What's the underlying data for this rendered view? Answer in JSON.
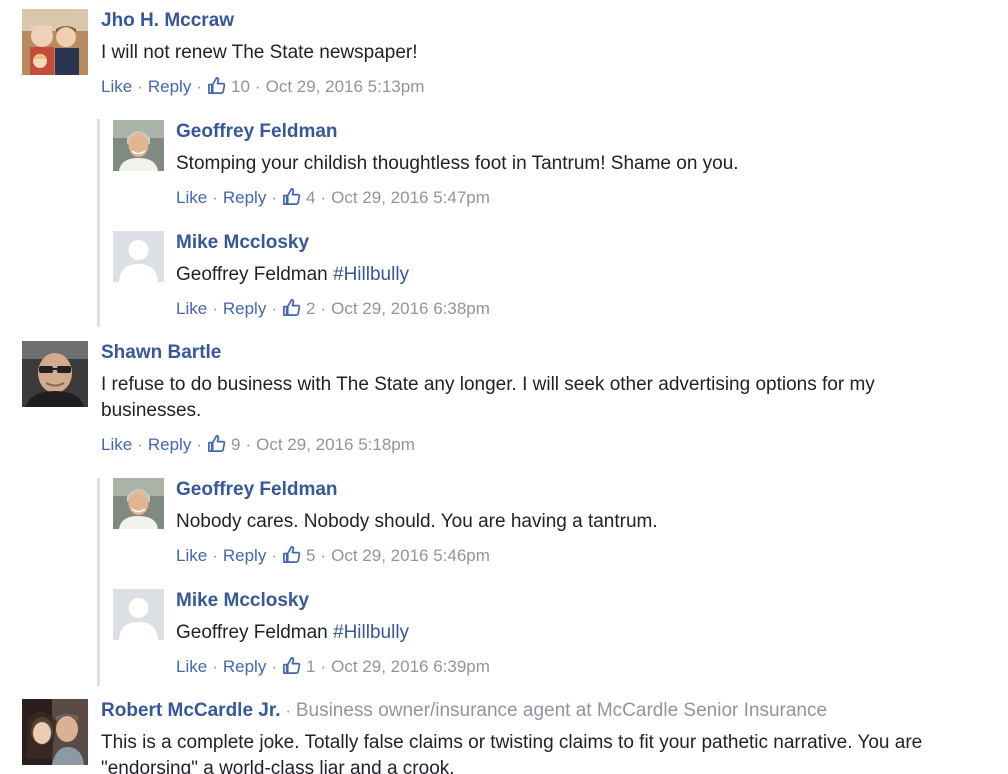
{
  "colors": {
    "link": "#4267b2",
    "author": "#365899",
    "meta": "#90949c",
    "text": "#1d2129",
    "thread_line": "#dddfe2"
  },
  "comments": [
    {
      "author": "Jho H. Mccraw",
      "text": "I will not renew The State newspaper!",
      "like_label": "Like",
      "reply_label": "Reply",
      "like_count": "10",
      "timestamp": "Oct 29, 2016 5:13pm",
      "avatar": "family-photo-avatar",
      "replies": [
        {
          "author": "Geoffrey Feldman",
          "text": "Stomping your childish thoughtless foot in Tantrum! Shame on you.",
          "like_label": "Like",
          "reply_label": "Reply",
          "like_count": "4",
          "timestamp": "Oct 29, 2016 5:47pm",
          "avatar": "gray-hair-man-avatar"
        },
        {
          "author": "Mike Mcclosky",
          "text_prefix": "Geoffrey Feldman ",
          "hashtag": "#Hillbully",
          "like_label": "Like",
          "reply_label": "Reply",
          "like_count": "2",
          "timestamp": "Oct 29, 2016 6:38pm",
          "avatar": "default-silhouette-avatar"
        }
      ]
    },
    {
      "author": "Shawn Bartle",
      "text": "I refuse to do business with The State any longer. I will seek other advertising options for my businesses.",
      "like_label": "Like",
      "reply_label": "Reply",
      "like_count": "9",
      "timestamp": "Oct 29, 2016 5:18pm",
      "avatar": "bald-man-sunglasses-avatar",
      "replies": [
        {
          "author": "Geoffrey Feldman",
          "text": "Nobody cares. Nobody should. You are having a tantrum.",
          "like_label": "Like",
          "reply_label": "Reply",
          "like_count": "5",
          "timestamp": "Oct 29, 2016 5:46pm",
          "avatar": "gray-hair-man-avatar"
        },
        {
          "author": "Mike Mcclosky",
          "text_prefix": "Geoffrey Feldman ",
          "hashtag": "#Hillbully",
          "like_label": "Like",
          "reply_label": "Reply",
          "like_count": "1",
          "timestamp": "Oct 29, 2016 6:39pm",
          "avatar": "default-silhouette-avatar"
        }
      ]
    },
    {
      "author": "Robert McCardle Jr.",
      "author_meta": "Business owner/insurance agent at McCardle Senior Insurance",
      "text": "This is a complete joke. Totally false claims or twisting claims to fit your pathetic narrative. You are \"endorsing\" a world-class liar and a crook.",
      "avatar": "couple-photo-avatar"
    }
  ]
}
